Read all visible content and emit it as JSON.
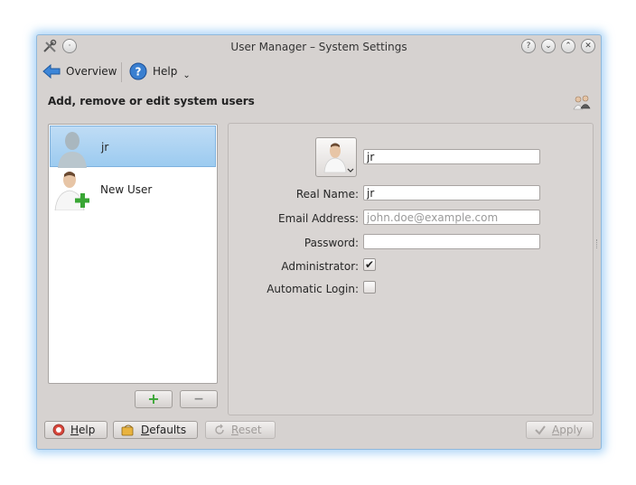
{
  "window": {
    "title": "User Manager – System Settings",
    "controls": {
      "help": "?",
      "minimize": "⌄",
      "maximize": "⌃",
      "close": "✕"
    }
  },
  "toolbar": {
    "overview_label": "Overview",
    "help_label": "Help",
    "help_dropdown": "⌄"
  },
  "header": {
    "title": "Add, remove or edit system users"
  },
  "users": [
    {
      "name": "jr",
      "selected": true
    },
    {
      "name": "New User",
      "selected": false
    }
  ],
  "list_buttons": {
    "add": "+",
    "remove": "−"
  },
  "form": {
    "username_value": "jr",
    "real_name_label": "Real Name:",
    "real_name_value": "jr",
    "email_label": "Email Address:",
    "email_placeholder": "john.doe@example.com",
    "password_label": "Password:",
    "password_value": "",
    "administrator_label": "Administrator:",
    "administrator_checked": true,
    "autologin_label": "Automatic Login:",
    "autologin_checked": false,
    "check_mark": "✔"
  },
  "bottom_buttons": {
    "help_prefix": "H",
    "help_rest": "elp",
    "defaults_prefix": "D",
    "defaults_rest": "efaults",
    "reset_prefix": "R",
    "reset_rest": "eset",
    "apply_prefix": "A",
    "apply_rest": "pply"
  },
  "colors": {
    "selection": "#9ccbf0",
    "window_glow": "#6eb4f0",
    "add_green": "#3aa635"
  }
}
